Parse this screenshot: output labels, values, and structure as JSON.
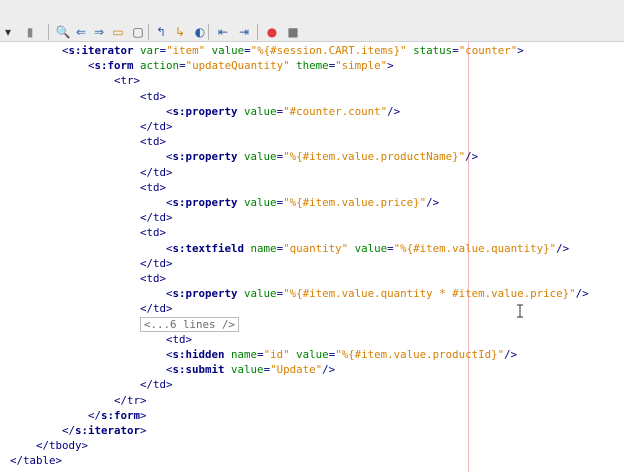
{
  "toolbar": {
    "buttons": [
      {
        "name": "dropdown-icon",
        "glyph": "▾"
      },
      {
        "name": "bookmark-icon",
        "glyph": "▮"
      },
      {
        "name": "find-icon",
        "glyph": "🔍"
      },
      {
        "name": "find-previous-icon",
        "glyph": "⇐"
      },
      {
        "name": "find-next-icon",
        "glyph": "⇒"
      },
      {
        "name": "toggle-highlight-icon",
        "glyph": "▭"
      },
      {
        "name": "toggle-rect-selection-icon",
        "glyph": "▢"
      },
      {
        "name": "previous-bookmark-icon",
        "glyph": "↰"
      },
      {
        "name": "next-bookmark-icon",
        "glyph": "↳"
      },
      {
        "name": "toggle-bookmark-icon",
        "glyph": "◐"
      },
      {
        "name": "shift-left-icon",
        "glyph": "⇤"
      },
      {
        "name": "shift-right-icon",
        "glyph": "⇥"
      },
      {
        "name": "record-macro-icon",
        "glyph": "●"
      },
      {
        "name": "stop-macro-icon",
        "glyph": "■"
      }
    ]
  },
  "editor": {
    "lines": [
      {
        "indent": 8,
        "parts": [
          [
            "punc",
            "<"
          ],
          [
            "tag",
            "s:iterator"
          ],
          [
            "plain",
            " "
          ],
          [
            "attr",
            "var"
          ],
          [
            "punc",
            "="
          ],
          [
            "val",
            "\"item\""
          ],
          [
            "plain",
            " "
          ],
          [
            "attr",
            "value"
          ],
          [
            "punc",
            "="
          ],
          [
            "val",
            "\"%{#session.CART.items}\""
          ],
          [
            "plain",
            " "
          ],
          [
            "attr",
            "status"
          ],
          [
            "punc",
            "="
          ],
          [
            "val",
            "\"counter\""
          ],
          [
            "punc",
            ">"
          ]
        ]
      },
      {
        "indent": 12,
        "parts": [
          [
            "punc",
            "<"
          ],
          [
            "tag",
            "s:form"
          ],
          [
            "plain",
            " "
          ],
          [
            "attr",
            "action"
          ],
          [
            "punc",
            "="
          ],
          [
            "val",
            "\"updateQuantity\""
          ],
          [
            "plain",
            " "
          ],
          [
            "attr",
            "theme"
          ],
          [
            "punc",
            "="
          ],
          [
            "val",
            "\"simple\""
          ],
          [
            "punc",
            ">"
          ]
        ]
      },
      {
        "indent": 16,
        "parts": [
          [
            "punc",
            "<"
          ],
          [
            "close",
            "tr"
          ],
          [
            "punc",
            ">"
          ]
        ]
      },
      {
        "indent": 20,
        "parts": [
          [
            "punc",
            "<"
          ],
          [
            "close",
            "td"
          ],
          [
            "punc",
            ">"
          ]
        ]
      },
      {
        "indent": 24,
        "parts": [
          [
            "punc",
            "<"
          ],
          [
            "tag",
            "s:property"
          ],
          [
            "plain",
            " "
          ],
          [
            "attr",
            "value"
          ],
          [
            "punc",
            "="
          ],
          [
            "val",
            "\"#counter.count\""
          ],
          [
            "punc",
            "/>"
          ]
        ]
      },
      {
        "indent": 20,
        "parts": [
          [
            "punc",
            "</"
          ],
          [
            "close",
            "td"
          ],
          [
            "punc",
            ">"
          ]
        ]
      },
      {
        "indent": 20,
        "parts": [
          [
            "punc",
            "<"
          ],
          [
            "close",
            "td"
          ],
          [
            "punc",
            ">"
          ]
        ]
      },
      {
        "indent": 24,
        "parts": [
          [
            "punc",
            "<"
          ],
          [
            "tag",
            "s:property"
          ],
          [
            "plain",
            " "
          ],
          [
            "attr",
            "value"
          ],
          [
            "punc",
            "="
          ],
          [
            "val",
            "\"%{#item.value.productName}\""
          ],
          [
            "punc",
            "/>"
          ]
        ]
      },
      {
        "indent": 20,
        "parts": [
          [
            "punc",
            "</"
          ],
          [
            "close",
            "td"
          ],
          [
            "punc",
            ">"
          ]
        ]
      },
      {
        "indent": 20,
        "parts": [
          [
            "punc",
            "<"
          ],
          [
            "close",
            "td"
          ],
          [
            "punc",
            ">"
          ]
        ]
      },
      {
        "indent": 24,
        "parts": [
          [
            "punc",
            "<"
          ],
          [
            "tag",
            "s:property"
          ],
          [
            "plain",
            " "
          ],
          [
            "attr",
            "value"
          ],
          [
            "punc",
            "="
          ],
          [
            "val",
            "\"%{#item.value.price}\""
          ],
          [
            "punc",
            "/>"
          ]
        ]
      },
      {
        "indent": 20,
        "parts": [
          [
            "punc",
            "</"
          ],
          [
            "close",
            "td"
          ],
          [
            "punc",
            ">"
          ]
        ]
      },
      {
        "indent": 20,
        "parts": [
          [
            "punc",
            "<"
          ],
          [
            "close",
            "td"
          ],
          [
            "punc",
            ">"
          ]
        ]
      },
      {
        "indent": 24,
        "parts": [
          [
            "punc",
            "<"
          ],
          [
            "tag",
            "s:textfield"
          ],
          [
            "plain",
            " "
          ],
          [
            "attr",
            "name"
          ],
          [
            "punc",
            "="
          ],
          [
            "val",
            "\"quantity\""
          ],
          [
            "plain",
            " "
          ],
          [
            "attr",
            "value"
          ],
          [
            "punc",
            "="
          ],
          [
            "val",
            "\"%{#item.value.quantity}\""
          ],
          [
            "punc",
            "/>"
          ]
        ]
      },
      {
        "indent": 20,
        "parts": [
          [
            "punc",
            "</"
          ],
          [
            "close",
            "td"
          ],
          [
            "punc",
            ">"
          ]
        ]
      },
      {
        "indent": 20,
        "parts": [
          [
            "punc",
            "<"
          ],
          [
            "close",
            "td"
          ],
          [
            "punc",
            ">"
          ]
        ]
      },
      {
        "indent": 24,
        "parts": [
          [
            "punc",
            "<"
          ],
          [
            "tag",
            "s:property"
          ],
          [
            "plain",
            " "
          ],
          [
            "attr",
            "value"
          ],
          [
            "punc",
            "="
          ],
          [
            "val",
            "\"%{#item.value.quantity * #item.value.price}\""
          ],
          [
            "punc",
            "/>"
          ]
        ]
      },
      {
        "indent": 20,
        "parts": [
          [
            "punc",
            "</"
          ],
          [
            "close",
            "td"
          ],
          [
            "punc",
            ">"
          ]
        ]
      },
      {
        "indent": 20,
        "fold": "<...6 lines />"
      },
      {
        "indent": 24,
        "parts": [
          [
            "punc",
            "<"
          ],
          [
            "close",
            "td"
          ],
          [
            "punc",
            ">"
          ]
        ]
      },
      {
        "indent": 24,
        "parts": [
          [
            "punc",
            "<"
          ],
          [
            "tag",
            "s:hidden"
          ],
          [
            "plain",
            " "
          ],
          [
            "attr",
            "name"
          ],
          [
            "punc",
            "="
          ],
          [
            "val",
            "\"id\""
          ],
          [
            "plain",
            " "
          ],
          [
            "attr",
            "value"
          ],
          [
            "punc",
            "="
          ],
          [
            "val",
            "\"%{#item.value.productId}\""
          ],
          [
            "punc",
            "/>"
          ]
        ]
      },
      {
        "indent": 24,
        "parts": [
          [
            "punc",
            "<"
          ],
          [
            "tag",
            "s:submit"
          ],
          [
            "plain",
            " "
          ],
          [
            "attr",
            "value"
          ],
          [
            "punc",
            "="
          ],
          [
            "val",
            "\"Update\""
          ],
          [
            "punc",
            "/>"
          ]
        ]
      },
      {
        "indent": 20,
        "parts": [
          [
            "punc",
            "</"
          ],
          [
            "close",
            "td"
          ],
          [
            "punc",
            ">"
          ]
        ]
      },
      {
        "indent": 16,
        "parts": [
          [
            "punc",
            "</"
          ],
          [
            "close",
            "tr"
          ],
          [
            "punc",
            ">"
          ]
        ]
      },
      {
        "indent": 12,
        "parts": [
          [
            "punc",
            "</"
          ],
          [
            "tag",
            "s:form"
          ],
          [
            "punc",
            ">"
          ]
        ]
      },
      {
        "indent": 8,
        "parts": [
          [
            "punc",
            "</"
          ],
          [
            "tag",
            "s:iterator"
          ],
          [
            "punc",
            ">"
          ]
        ]
      },
      {
        "indent": 4,
        "parts": [
          [
            "punc",
            "</"
          ],
          [
            "close",
            "tbody"
          ],
          [
            "punc",
            ">"
          ]
        ]
      },
      {
        "indent": 0,
        "parts": [
          [
            "punc",
            "</"
          ],
          [
            "close",
            "table"
          ],
          [
            "punc",
            ">"
          ]
        ]
      }
    ]
  }
}
